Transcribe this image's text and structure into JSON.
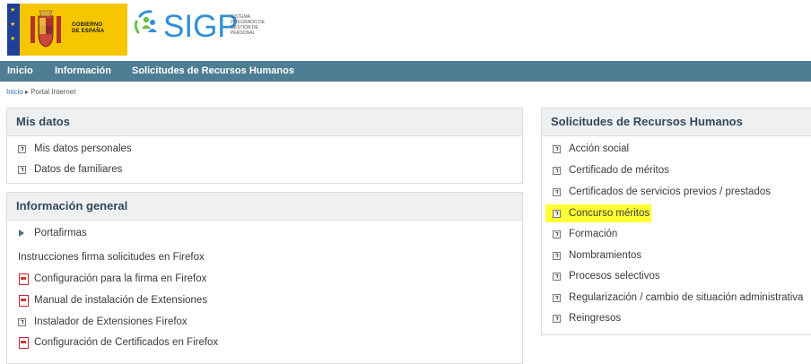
{
  "header": {
    "gov_line1": "GOBIERNO",
    "gov_line2": "DE ESPAÑA",
    "logo_text": "SIGP",
    "logo_sub": [
      "SISTEMA",
      "INTEGRADO DE",
      "GESTIÓN DE",
      "PERSONAL"
    ]
  },
  "nav": {
    "items": [
      "Inicio",
      "Información",
      "Solicitudes de Recursos Humanos"
    ]
  },
  "breadcrumb": {
    "home": "Inicio",
    "separator": "▸",
    "current": "Portal Internet"
  },
  "mis_datos": {
    "title": "Mis datos",
    "items": [
      "Mis datos personales",
      "Datos de familiares"
    ]
  },
  "info_general": {
    "title": "Información general",
    "portafirmas": "Portafirmas",
    "section_label": "Instrucciones firma solicitudes en Firefox",
    "items": [
      "Configuración para la firma en Firefox",
      "Manual de instalación de Extensiones",
      "Instalador de Extensiones Firefox",
      "Configuración de Certificados en Firefox"
    ]
  },
  "solicitudes": {
    "title": "Solicitudes de Recursos Humanos",
    "items": [
      "Acción social",
      "Certificado de méritos",
      "Certificados de servicios previos / prestados",
      "Concurso méritos",
      "Formación",
      "Nombramientos",
      "Procesos selectivos",
      "Regularización / cambio de situación administrativa",
      "Reingresos"
    ],
    "highlighted_item": "Concurso méritos",
    "highlight_color": "#ffff33"
  },
  "colors": {
    "navbar": "#4d7e93",
    "panel_header_bg": "#eef0f2",
    "logo_blue": "#2f8fd9",
    "gov_yellow": "#f6c600"
  }
}
